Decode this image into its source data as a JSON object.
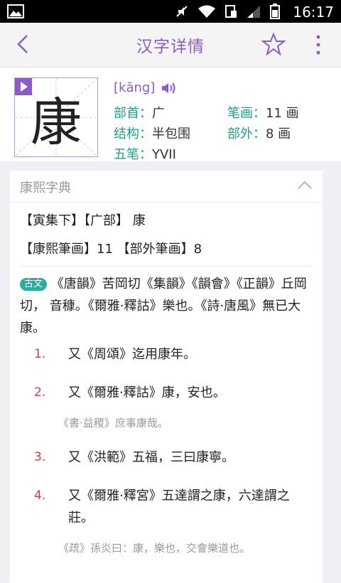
{
  "status": {
    "time": "16:17"
  },
  "appbar": {
    "title": "汉字详情"
  },
  "character": {
    "char": "康",
    "pinyin": "[kāng]",
    "bushou_label": "部首：",
    "bushou": "广",
    "bihua_label": "笔画：",
    "bihua": "11 画",
    "jiegou_label": "结构：",
    "jiegou": "半包围",
    "buwai_label": "部外：",
    "buwai": "8 画",
    "wubi_label": "五笔：",
    "wubi": "YVII"
  },
  "card": {
    "title": "康熙字典",
    "line1": "【寅集下】【广部】 康",
    "line2": "【康熙筆画】11 【部外筆画】8",
    "badge": "古文",
    "intro": "《唐韻》苦岡切《集韻》《韻會》《正韻》丘岡切， 音穅。《爾雅·釋詁》樂也。《詩·唐風》無已大康。",
    "definitions": [
      {
        "num": "1.",
        "text": "又《周頌》迄用康年。",
        "quote": ""
      },
      {
        "num": "2.",
        "text": "又《爾雅·釋詁》康，安也。",
        "quote": "《書·益稷》庶事康哉。"
      },
      {
        "num": "3.",
        "text": "又《洪範》五福，三曰康寧。",
        "quote": ""
      },
      {
        "num": "4.",
        "text": "又《爾雅·釋宮》五達謂之康，六達謂之莊。",
        "quote": "《疏》孫炎曰：康，樂也，交會樂道也。"
      }
    ]
  },
  "colors": {
    "accent": "#8b5cc7",
    "label": "#1aa38a",
    "number": "#d23c3c"
  }
}
